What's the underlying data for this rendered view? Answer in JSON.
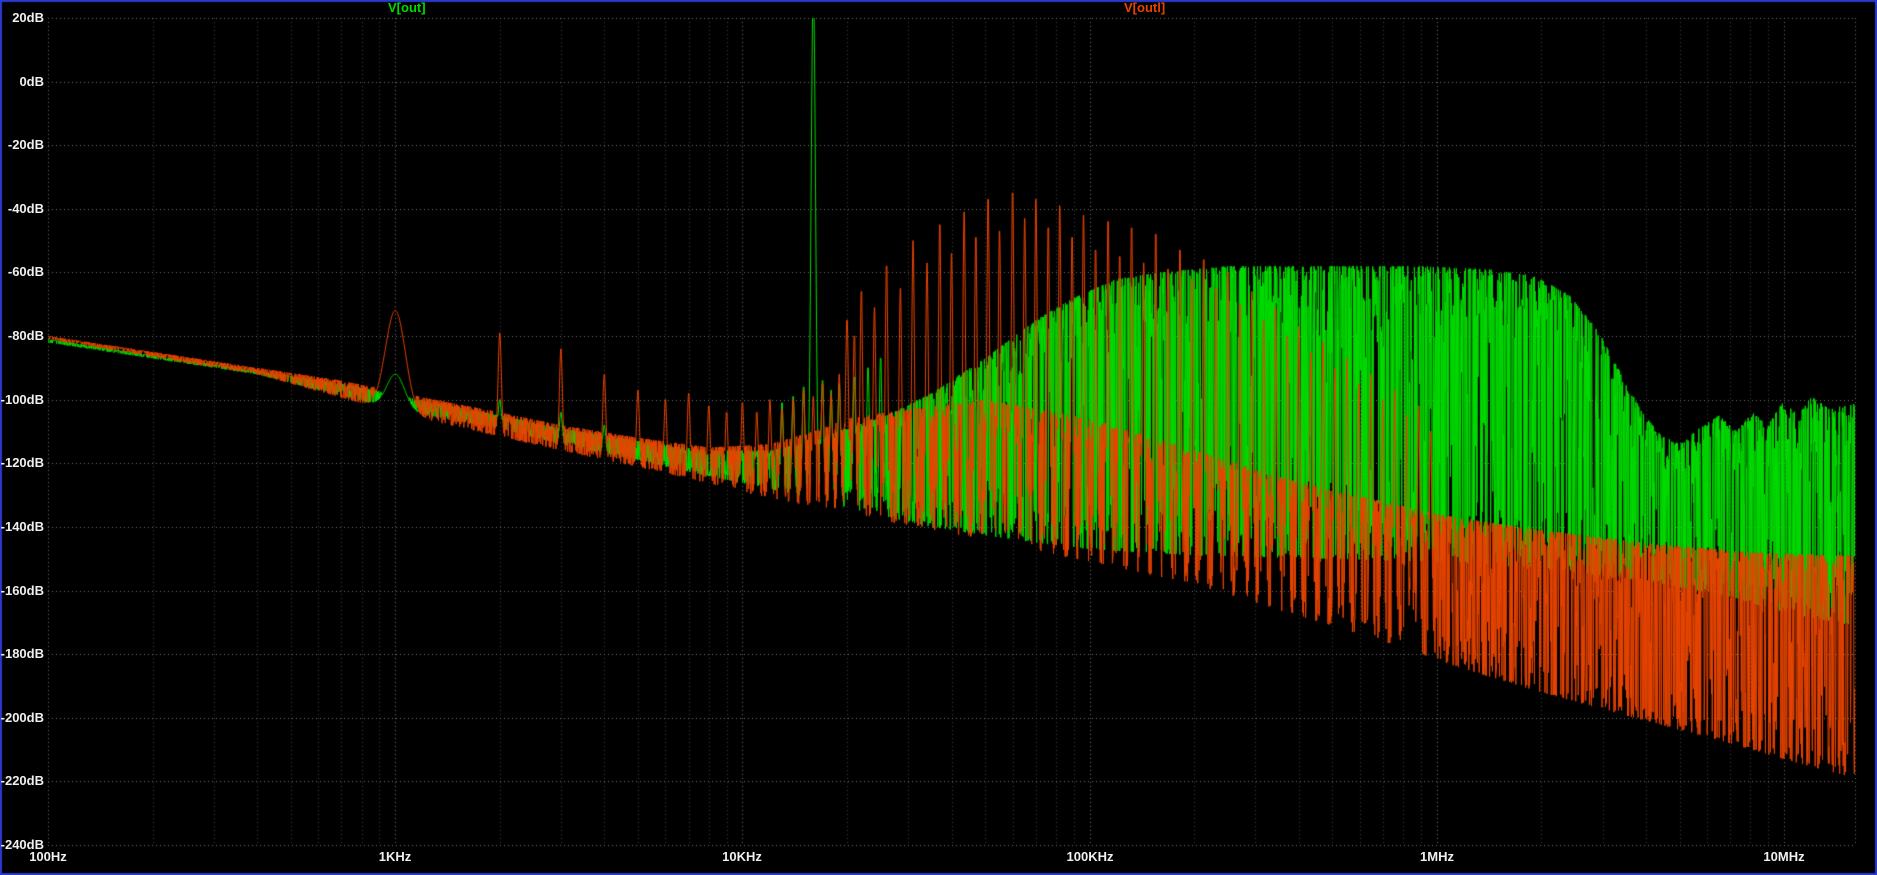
{
  "window": {
    "background": "#000000",
    "border_color": "#2a3ad0",
    "text_color": "#f0f0f0"
  },
  "chart_data": {
    "type": "line",
    "title": "",
    "legend_position": "top",
    "x_axis": {
      "scale": "log",
      "unit": "Hz",
      "min_hz": 100,
      "max_hz": 16000000,
      "ticks": [
        {
          "hz": 100,
          "label": "100Hz"
        },
        {
          "hz": 1000,
          "label": "1KHz"
        },
        {
          "hz": 10000,
          "label": "10KHz"
        },
        {
          "hz": 100000,
          "label": "100KHz"
        },
        {
          "hz": 1000000,
          "label": "1MHz"
        },
        {
          "hz": 10000000,
          "label": "10MHz"
        }
      ]
    },
    "y_axis": {
      "unit": "dB",
      "min_db": -240,
      "max_db": 20,
      "step_db": 20,
      "tick_labels": [
        "20dB",
        "0dB",
        "-20dB",
        "-40dB",
        "-60dB",
        "-80dB",
        "-100dB",
        "-120dB",
        "-140dB",
        "-160dB",
        "-180dB",
        "-200dB",
        "-220dB",
        "-240dB"
      ]
    },
    "grid": {
      "major_color": "#6e6e6e",
      "minor_color": "#3e3e3e"
    },
    "series": [
      {
        "name": "V[out]",
        "color": "#00dc00",
        "description": "FFT spectrum, noise-shaped output with large tone spike near 16-20KHz (clipped at top of plot) and wide -60dB noise plateau from 100KHz to 2MHz rolling off above 2.5MHz",
        "envelope_top": [
          [
            100,
            -81
          ],
          [
            200,
            -86
          ],
          [
            400,
            -91
          ],
          [
            700,
            -95
          ],
          [
            1300,
            -101
          ],
          [
            2000,
            -105
          ],
          [
            3000,
            -109
          ],
          [
            5000,
            -113
          ],
          [
            8000,
            -116
          ],
          [
            12000,
            -116
          ],
          [
            16000,
            -113
          ],
          [
            20000,
            -109
          ],
          [
            26000,
            -105
          ],
          [
            35000,
            -98
          ],
          [
            50000,
            -87
          ],
          [
            70000,
            -75
          ],
          [
            90000,
            -68
          ],
          [
            120000,
            -62
          ],
          [
            160000,
            -60
          ],
          [
            250000,
            -58
          ],
          [
            500000,
            -58
          ],
          [
            900000,
            -58
          ],
          [
            1400000,
            -59
          ],
          [
            1900000,
            -61
          ],
          [
            2400000,
            -67
          ],
          [
            2900000,
            -78
          ],
          [
            3400000,
            -92
          ],
          [
            3900000,
            -104
          ],
          [
            4400000,
            -111
          ],
          [
            5000000,
            -114
          ],
          [
            5700000,
            -109
          ],
          [
            6500000,
            -105
          ],
          [
            7300000,
            -110
          ],
          [
            8100000,
            -104
          ],
          [
            9000000,
            -108
          ],
          [
            10000000,
            -100
          ],
          [
            11000000,
            -105
          ],
          [
            12000000,
            -99
          ],
          [
            13500000,
            -103
          ],
          [
            16000000,
            -101
          ]
        ],
        "envelope_bottom": [
          [
            100,
            -82
          ],
          [
            400,
            -92
          ],
          [
            1000,
            -103
          ],
          [
            2000,
            -109
          ],
          [
            3000,
            -114
          ],
          [
            5000,
            -119
          ],
          [
            8000,
            -124
          ],
          [
            12000,
            -128
          ],
          [
            20000,
            -134
          ],
          [
            35000,
            -140
          ],
          [
            60000,
            -144
          ],
          [
            100000,
            -147
          ],
          [
            200000,
            -149
          ],
          [
            500000,
            -150
          ],
          [
            1000000,
            -151
          ],
          [
            2000000,
            -153
          ],
          [
            4000000,
            -157
          ],
          [
            7000000,
            -162
          ],
          [
            10000000,
            -167
          ],
          [
            16000000,
            -171
          ]
        ],
        "peaks": [
          [
            1000,
            -92,
            9
          ],
          [
            2000,
            -100,
            1.4
          ],
          [
            3000,
            -104,
            1.4
          ],
          [
            4000,
            -108,
            1.4
          ],
          [
            13000,
            -101,
            1.4
          ],
          [
            14000,
            -99,
            1.4
          ],
          [
            15000,
            -96,
            1.4
          ],
          [
            16000,
            30,
            2.2
          ],
          [
            17000,
            -94,
            1.4
          ],
          [
            18000,
            -97,
            1.4
          ],
          [
            19000,
            -95,
            1.4
          ],
          [
            21000,
            -93,
            1.4
          ],
          [
            23000,
            -90,
            1.4
          ],
          [
            25000,
            -87,
            1.4
          ]
        ],
        "texture": {
          "seed": 1337,
          "p_top": 0.45,
          "p_bottom": 0.28
        }
      },
      {
        "name": "V[outl]",
        "color": "#e84400",
        "description": "FFT spectrum, filtered output with 1KHz fundamental bump, 1KHz-spaced harmonic spikes up to 20KHz, tall spike forest peaking near -36dB between 30KHz and 160KHz, noise floor falling to about -220dB at 10MHz",
        "envelope_top": [
          [
            100,
            -80
          ],
          [
            200,
            -85
          ],
          [
            400,
            -90
          ],
          [
            700,
            -94
          ],
          [
            1300,
            -100
          ],
          [
            2000,
            -104
          ],
          [
            3000,
            -108
          ],
          [
            5000,
            -112
          ],
          [
            8000,
            -115
          ],
          [
            12000,
            -114
          ],
          [
            16000,
            -110
          ],
          [
            20000,
            -106
          ],
          [
            30000,
            -103
          ],
          [
            50000,
            -100
          ],
          [
            100000,
            -106
          ],
          [
            200000,
            -116
          ],
          [
            400000,
            -126
          ],
          [
            700000,
            -132
          ],
          [
            1000000,
            -136
          ],
          [
            2000000,
            -141
          ],
          [
            4000000,
            -145
          ],
          [
            8000000,
            -148
          ],
          [
            16000000,
            -149
          ]
        ],
        "envelope_bottom": [
          [
            100,
            -81
          ],
          [
            400,
            -92
          ],
          [
            1000,
            -104
          ],
          [
            3000,
            -116
          ],
          [
            6000,
            -123
          ],
          [
            10000,
            -129
          ],
          [
            20000,
            -136
          ],
          [
            50000,
            -144
          ],
          [
            100000,
            -151
          ],
          [
            200000,
            -158
          ],
          [
            400000,
            -168
          ],
          [
            700000,
            -176
          ],
          [
            1000000,
            -182
          ],
          [
            2000000,
            -192
          ],
          [
            4000000,
            -201
          ],
          [
            7000000,
            -208
          ],
          [
            10000000,
            -213
          ],
          [
            16000000,
            -219
          ]
        ],
        "peaks": [
          [
            1000,
            -72,
            10
          ],
          [
            2000,
            -79,
            1.6
          ],
          [
            3000,
            -84,
            1.5
          ],
          [
            4000,
            -92,
            1.5
          ],
          [
            5000,
            -97,
            1.4
          ],
          [
            6000,
            -100,
            1.4
          ],
          [
            7000,
            -98,
            1.4
          ],
          [
            8000,
            -102,
            1.4
          ],
          [
            9000,
            -104,
            1.4
          ],
          [
            10000,
            -101,
            1.4
          ],
          [
            11000,
            -104,
            1.4
          ],
          [
            12000,
            -100,
            1.4
          ],
          [
            13000,
            -103,
            1.4
          ],
          [
            14000,
            -100,
            1.4
          ],
          [
            15000,
            -97,
            1.4
          ],
          [
            16000,
            -99,
            1.4
          ],
          [
            17000,
            -95,
            1.4
          ],
          [
            18000,
            -98,
            1.4
          ],
          [
            19000,
            -92,
            1.4
          ],
          [
            20000,
            -75,
            1.6
          ],
          [
            21000,
            -80,
            1.4
          ],
          [
            22000,
            -66,
            1.4
          ],
          [
            24000,
            -71,
            1.4
          ],
          [
            26000,
            -58,
            1.4
          ],
          [
            28500,
            -65,
            1.4
          ],
          [
            31000,
            -50,
            1.4
          ],
          [
            34000,
            -57,
            1.4
          ],
          [
            37000,
            -45,
            1.4
          ],
          [
            40000,
            -54,
            1.4
          ],
          [
            43500,
            -41,
            1.4
          ],
          [
            47000,
            -49,
            1.4
          ],
          [
            51000,
            -37,
            1.4
          ],
          [
            55000,
            -47,
            1.4
          ],
          [
            60000,
            -35,
            1.4
          ],
          [
            65000,
            -43,
            1.4
          ],
          [
            70000,
            -37,
            1.4
          ],
          [
            76000,
            -46,
            1.4
          ],
          [
            82000,
            -39,
            1.4
          ],
          [
            89000,
            -49,
            1.4
          ],
          [
            96000,
            -42,
            1.4
          ],
          [
            104000,
            -53,
            1.4
          ],
          [
            113000,
            -44,
            1.4
          ],
          [
            122000,
            -55,
            1.4
          ],
          [
            132000,
            -46,
            1.4
          ],
          [
            143000,
            -57,
            1.4
          ],
          [
            155000,
            -48,
            1.4
          ],
          [
            168000,
            -59,
            1.4
          ],
          [
            182000,
            -53,
            1.4
          ],
          [
            197000,
            -62,
            1.4
          ],
          [
            213000,
            -56,
            1.4
          ],
          [
            231000,
            -65,
            1.4
          ],
          [
            250000,
            -60,
            1.4
          ],
          [
            271000,
            -70,
            1.4
          ],
          [
            293000,
            -66,
            1.4
          ],
          [
            317000,
            -75,
            1.4
          ],
          [
            343000,
            -71,
            1.4
          ],
          [
            371000,
            -80,
            1.4
          ],
          [
            400000,
            -77,
            1.4
          ],
          [
            434000,
            -85,
            1.4
          ],
          [
            470000,
            -82,
            1.4
          ],
          [
            509000,
            -90,
            1.4
          ],
          [
            551000,
            -87,
            1.4
          ],
          [
            596000,
            -95,
            1.4
          ],
          [
            645000,
            -92,
            1.4
          ],
          [
            698000,
            -100,
            1.4
          ],
          [
            756000,
            -97,
            1.4
          ],
          [
            818000,
            -105,
            1.4
          ],
          [
            886000,
            -102,
            1.4
          ],
          [
            959000,
            -110,
            1.4
          ]
        ],
        "texture": {
          "seed": 424242,
          "p_top": 0.45,
          "p_bottom": 0.25
        }
      }
    ]
  }
}
